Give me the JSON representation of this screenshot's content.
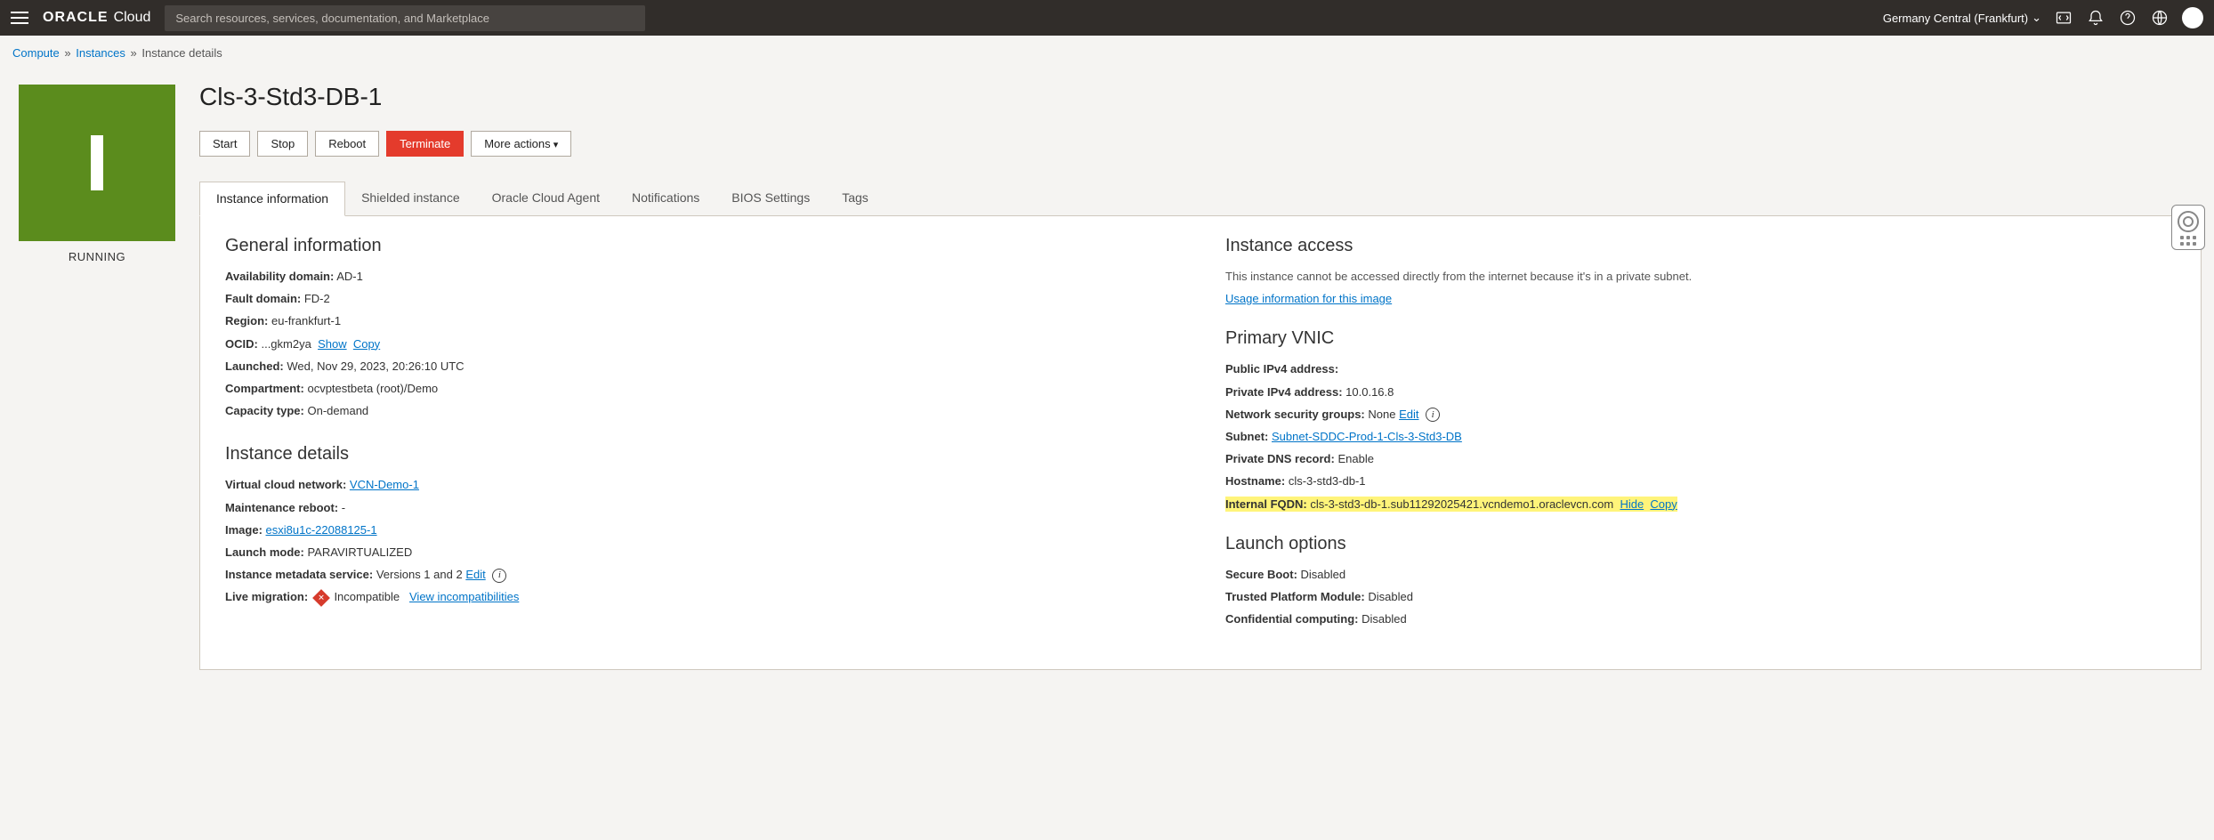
{
  "topbar": {
    "brand_bold": "ORACLE",
    "brand_light": "Cloud",
    "search_placeholder": "Search resources, services, documentation, and Marketplace",
    "region": "Germany Central (Frankfurt)"
  },
  "breadcrumbs": {
    "compute": "Compute",
    "instances": "Instances",
    "current": "Instance details"
  },
  "status": {
    "label": "RUNNING"
  },
  "page_title": "Cls-3-Std3-DB-1",
  "actions": {
    "start": "Start",
    "stop": "Stop",
    "reboot": "Reboot",
    "terminate": "Terminate",
    "more": "More actions"
  },
  "tabs": {
    "t0": "Instance information",
    "t1": "Shielded instance",
    "t2": "Oracle Cloud Agent",
    "t3": "Notifications",
    "t4": "BIOS Settings",
    "t5": "Tags"
  },
  "general": {
    "heading": "General information",
    "ad_label": "Availability domain:",
    "ad_value": "AD-1",
    "fd_label": "Fault domain:",
    "fd_value": "FD-2",
    "region_label": "Region:",
    "region_value": "eu-frankfurt-1",
    "ocid_label": "OCID:",
    "ocid_value": "...gkm2ya",
    "show": "Show",
    "copy": "Copy",
    "launched_label": "Launched:",
    "launched_value": "Wed, Nov 29, 2023, 20:26:10 UTC",
    "compartment_label": "Compartment:",
    "compartment_value": "ocvptestbeta (root)/Demo",
    "capacity_label": "Capacity type:",
    "capacity_value": "On-demand"
  },
  "details": {
    "heading": "Instance details",
    "vcn_label": "Virtual cloud network:",
    "vcn_value": "VCN-Demo-1",
    "maint_label": "Maintenance reboot:",
    "maint_value": "-",
    "image_label": "Image:",
    "image_value": "esxi8u1c-22088125-1",
    "launchmode_label": "Launch mode:",
    "launchmode_value": "PARAVIRTUALIZED",
    "metadata_label": "Instance metadata service:",
    "metadata_value": "Versions 1 and 2",
    "edit": "Edit",
    "livemig_label": "Live migration:",
    "livemig_value": "Incompatible",
    "view_incompat": "View incompatibilities"
  },
  "access": {
    "heading": "Instance access",
    "note": "This instance cannot be accessed directly from the internet because it's in a private subnet.",
    "usage_link": "Usage information for this image"
  },
  "vnic": {
    "heading": "Primary VNIC",
    "pub_label": "Public IPv4 address:",
    "pub_value": "",
    "priv_label": "Private IPv4 address:",
    "priv_value": "10.0.16.8",
    "nsg_label": "Network security groups:",
    "nsg_value": "None",
    "nsg_edit": "Edit",
    "subnet_label": "Subnet:",
    "subnet_value": "Subnet-SDDC-Prod-1-Cls-3-Std3-DB",
    "dns_label": "Private DNS record:",
    "dns_value": "Enable",
    "hostname_label": "Hostname:",
    "hostname_value": "cls-3-std3-db-1",
    "fqdn_label": "Internal FQDN:",
    "fqdn_value": "cls-3-std3-db-1.sub11292025421.vcndemo1.oraclevcn.com",
    "hide": "Hide",
    "copy": "Copy"
  },
  "launch": {
    "heading": "Launch options",
    "secure_label": "Secure Boot:",
    "secure_value": "Disabled",
    "tpm_label": "Trusted Platform Module:",
    "tpm_value": "Disabled",
    "conf_label": "Confidential computing:",
    "conf_value": "Disabled"
  }
}
